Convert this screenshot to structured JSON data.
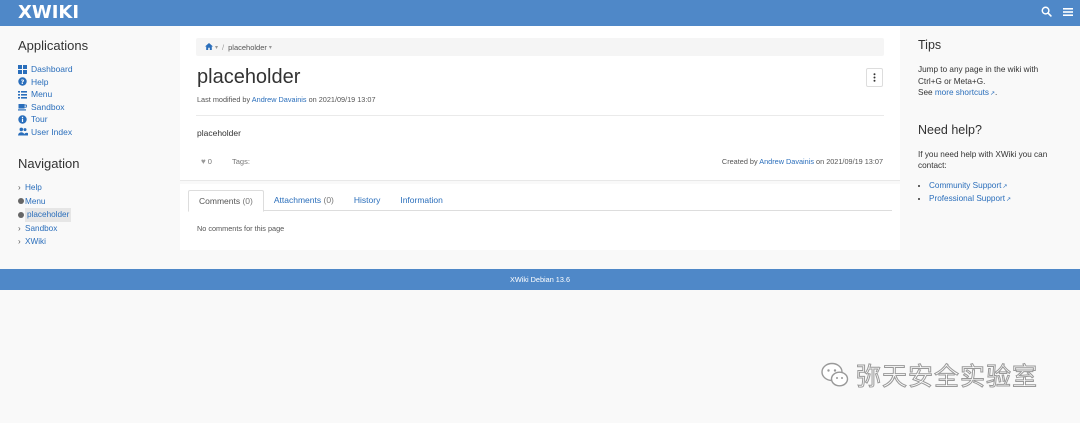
{
  "header": {
    "logo": "XWIKI",
    "search_icon": "search-icon",
    "menu_icon": "hamburger-icon"
  },
  "left_panel": {
    "applications_title": "Applications",
    "applications": [
      {
        "label": "Dashboard",
        "icon": "dashboard-icon"
      },
      {
        "label": "Help",
        "icon": "help-icon"
      },
      {
        "label": "Menu",
        "icon": "list-icon"
      },
      {
        "label": "Sandbox",
        "icon": "cup-icon"
      },
      {
        "label": "Tour",
        "icon": "info-icon"
      },
      {
        "label": "User Index",
        "icon": "users-icon"
      }
    ],
    "navigation_title": "Navigation",
    "navigation": [
      {
        "label": "Help",
        "marker": "chevron"
      },
      {
        "label": "Menu",
        "marker": "dot"
      },
      {
        "label": "placeholder",
        "marker": "dot",
        "current": true
      },
      {
        "label": "Sandbox",
        "marker": "chevron"
      },
      {
        "label": "XWiki",
        "marker": "chevron"
      }
    ]
  },
  "breadcrumb": {
    "home_icon": "home-icon",
    "current": "placeholder"
  },
  "page": {
    "title": "placeholder",
    "last_modified_prefix": "Last modified by",
    "last_modified_author": "Andrew Davainis",
    "last_modified_suffix": "on 2021/09/19 13:07",
    "content": "placeholder",
    "likes": "0",
    "tags_label": "Tags:",
    "created_prefix": "Created by",
    "created_author": "Andrew Davainis",
    "created_suffix": "on 2021/09/19 13:07"
  },
  "tabs": [
    {
      "label": "Comments",
      "count": "(0)",
      "active": true
    },
    {
      "label": "Attachments",
      "count": "(0)"
    },
    {
      "label": "History",
      "count": ""
    },
    {
      "label": "Information",
      "count": ""
    }
  ],
  "tab_content": "No comments for this page",
  "right_panel": {
    "tips_title": "Tips",
    "tips_line1": "Jump to any page in the wiki with",
    "tips_line2": "Ctrl+G or Meta+G.",
    "tips_see": "See",
    "tips_link": "more shortcuts",
    "tips_end": ".",
    "help_title": "Need help?",
    "help_text": "If you need help with XWiki you can contact:",
    "help_links": [
      "Community Support",
      "Professional Support"
    ]
  },
  "footer": {
    "text": "XWiki Debian 13.6"
  },
  "watermark": {
    "text": "弥天安全实验室"
  },
  "colors": {
    "brand": "#4f88c8",
    "link": "#2a6ebb"
  }
}
